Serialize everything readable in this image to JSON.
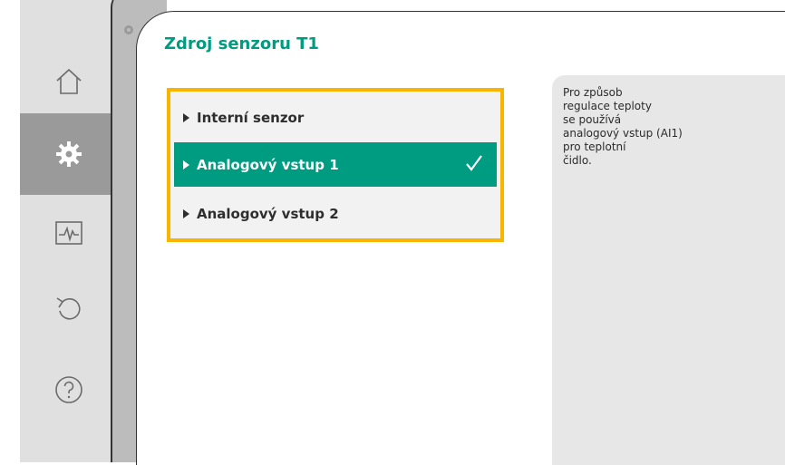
{
  "nav": {
    "items": [
      {
        "icon": "home-icon"
      },
      {
        "icon": "gear-icon",
        "active": true
      },
      {
        "icon": "diagnostics-icon"
      },
      {
        "icon": "undo-icon"
      },
      {
        "icon": "help-icon"
      }
    ]
  },
  "page": {
    "title": "Zdroj senzoru T1",
    "options": [
      {
        "label": "Interní senzor",
        "selected": false
      },
      {
        "label": "Analogový vstup 1",
        "selected": true
      },
      {
        "label": "Analogový vstup 2",
        "selected": false
      }
    ],
    "info_text": "Pro způsob\nregulace teploty\nse používá\nanalogový vstup (AI1)\npro teplotní\nčidlo."
  },
  "colors": {
    "accent": "#009c82",
    "focus_border": "#f7b500",
    "sidebar_bg": "#e0e0e0",
    "active_nav": "#9a9a9a"
  }
}
